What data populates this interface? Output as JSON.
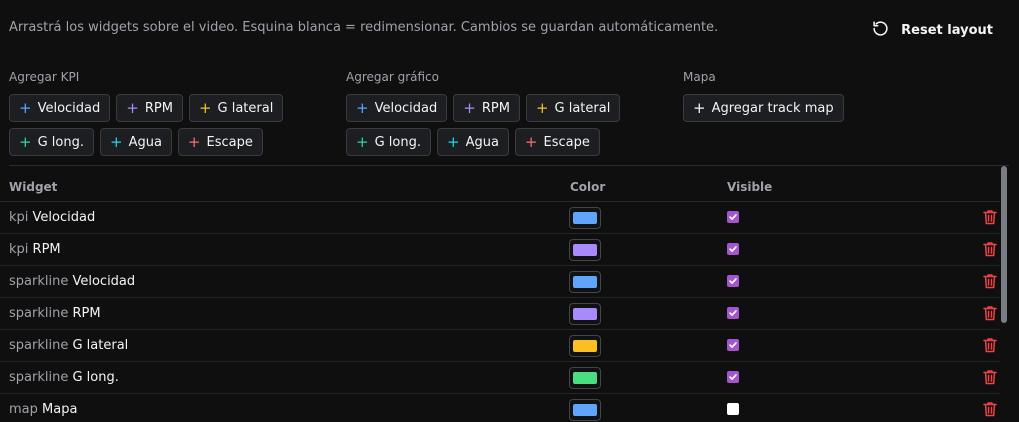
{
  "header": {
    "hint": "Arrastrá los widgets sobre el video. Esquina blanca = redimensionar. Cambios se guardan automáticamente.",
    "reset_label": "Reset layout"
  },
  "groups": {
    "kpi": {
      "label": "Agregar KPI",
      "items": [
        {
          "label": "Velocidad",
          "color": "#60a5fa"
        },
        {
          "label": "RPM",
          "color": "#a78bfa"
        },
        {
          "label": "G lateral",
          "color": "#fbbf24"
        },
        {
          "label": "G long.",
          "color": "#34d399"
        },
        {
          "label": "Agua",
          "color": "#22d3ee"
        },
        {
          "label": "Escape",
          "color": "#f87171"
        }
      ]
    },
    "chart": {
      "label": "Agregar gráfico",
      "items": [
        {
          "label": "Velocidad",
          "color": "#60a5fa"
        },
        {
          "label": "RPM",
          "color": "#a78bfa"
        },
        {
          "label": "G lateral",
          "color": "#fbbf24"
        },
        {
          "label": "G long.",
          "color": "#34d399"
        },
        {
          "label": "Agua",
          "color": "#22d3ee"
        },
        {
          "label": "Escape",
          "color": "#f87171"
        }
      ]
    },
    "map": {
      "label": "Mapa",
      "items": [
        {
          "label": "Agregar track map",
          "color": "#f4f4f5"
        }
      ]
    }
  },
  "table": {
    "headers": {
      "widget": "Widget",
      "color": "Color",
      "visible": "Visible"
    },
    "rows": [
      {
        "type": "kpi",
        "name": "Velocidad",
        "color": "#60a5fa",
        "visible": true
      },
      {
        "type": "kpi",
        "name": "RPM",
        "color": "#a78bfa",
        "visible": true
      },
      {
        "type": "sparkline",
        "name": "Velocidad",
        "color": "#60a5fa",
        "visible": true
      },
      {
        "type": "sparkline",
        "name": "RPM",
        "color": "#a78bfa",
        "visible": true
      },
      {
        "type": "sparkline",
        "name": "G lateral",
        "color": "#fbbf24",
        "visible": true
      },
      {
        "type": "sparkline",
        "name": "G long.",
        "color": "#4ade80",
        "visible": true
      },
      {
        "type": "map",
        "name": "Mapa",
        "color": "#60a5fa",
        "visible": false
      }
    ]
  },
  "icons": {
    "reset": "rotate-ccw-icon",
    "delete": "trash-icon",
    "add": "plus-icon"
  },
  "colors": {
    "delete": "#ef4444",
    "checkbox": "#a355d0"
  }
}
